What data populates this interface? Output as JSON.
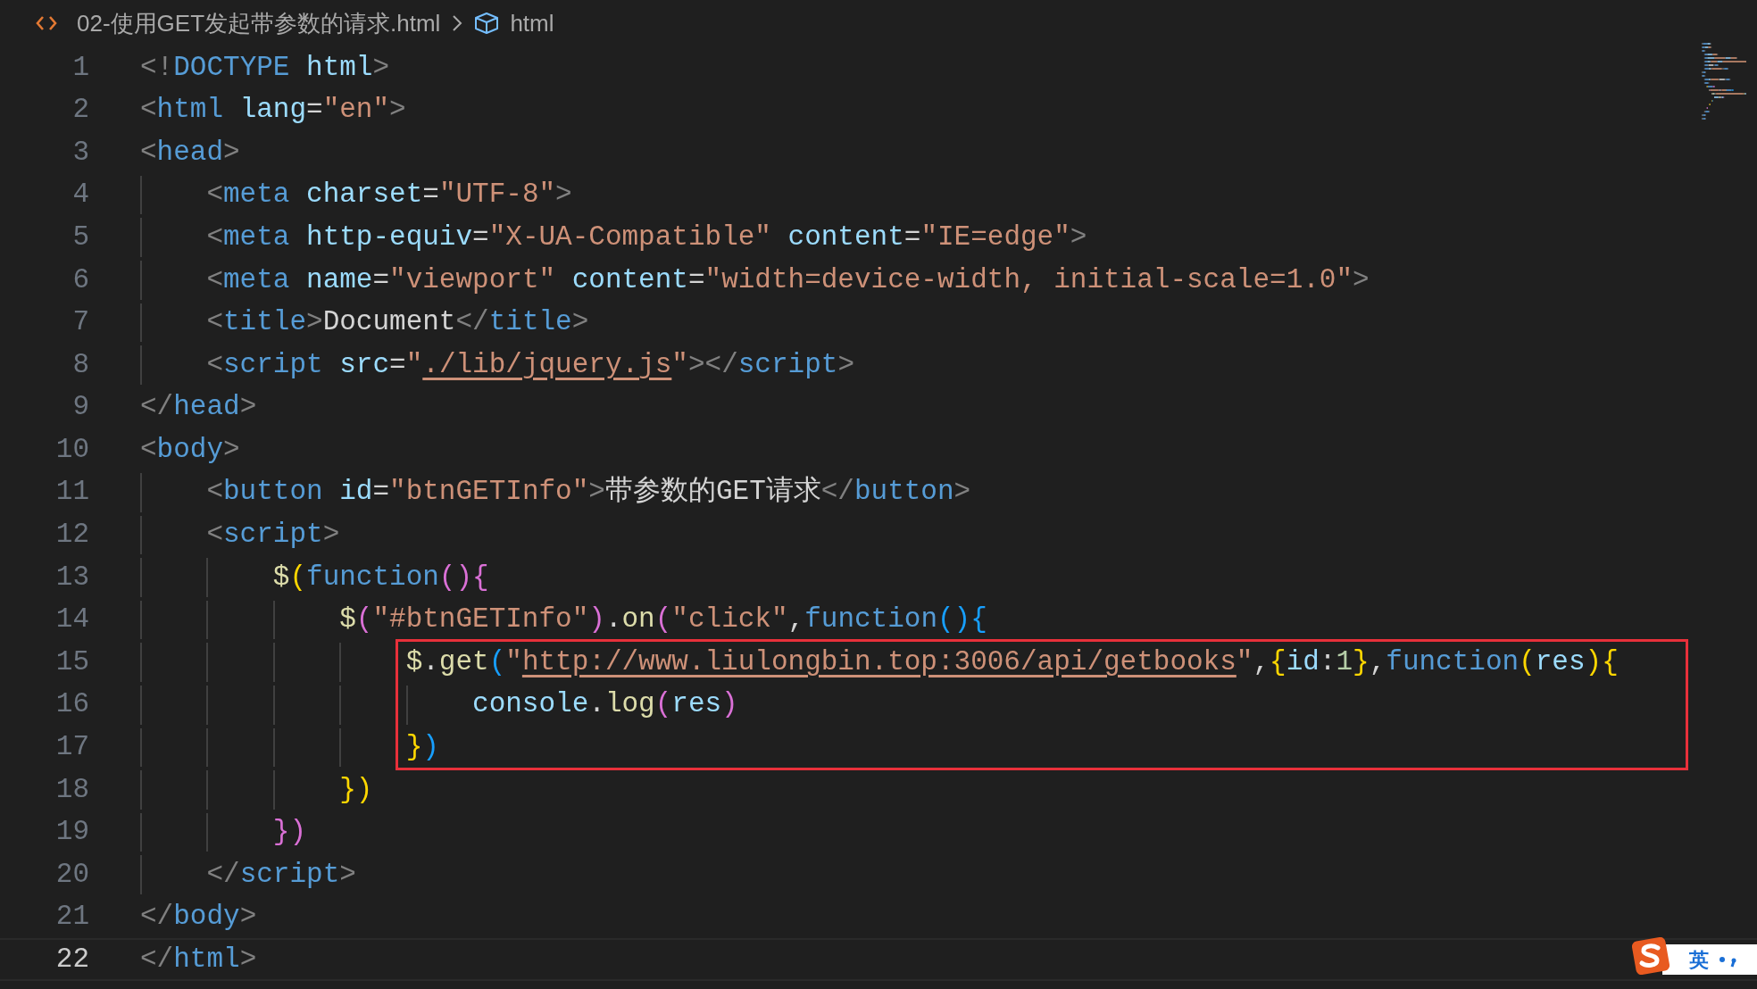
{
  "breadcrumb": {
    "file": "02-使用GET发起带参数的请求.html",
    "symbol": "html"
  },
  "lines": [
    {
      "number": "1",
      "current": false,
      "boxed": false,
      "tokens": [
        {
          "kind": "p",
          "text": "<!"
        },
        {
          "kind": "tag",
          "text": "DOCTYPE"
        },
        {
          "kind": "attr",
          "text": " html"
        },
        {
          "kind": "p",
          "text": ">"
        }
      ]
    },
    {
      "number": "2",
      "current": false,
      "boxed": false,
      "tokens": [
        {
          "kind": "p",
          "text": "<"
        },
        {
          "kind": "tag",
          "text": "html"
        },
        {
          "kind": "attr",
          "text": " lang"
        },
        {
          "kind": "txt",
          "text": "="
        },
        {
          "kind": "str",
          "text": "\"en\""
        },
        {
          "kind": "p",
          "text": ">"
        }
      ]
    },
    {
      "number": "3",
      "current": false,
      "boxed": false,
      "tokens": [
        {
          "kind": "p",
          "text": "<"
        },
        {
          "kind": "tag",
          "text": "head"
        },
        {
          "kind": "p",
          "text": ">"
        }
      ],
      "children": [
        {
          "number": "4",
          "current": false,
          "boxed": false,
          "tokens": [
            {
              "kind": "p",
              "text": "<"
            },
            {
              "kind": "tag",
              "text": "meta"
            },
            {
              "kind": "attr",
              "text": " charset"
            },
            {
              "kind": "txt",
              "text": "="
            },
            {
              "kind": "str",
              "text": "\"UTF-8\""
            },
            {
              "kind": "p",
              "text": ">"
            }
          ]
        },
        {
          "number": "5",
          "current": false,
          "boxed": false,
          "tokens": [
            {
              "kind": "p",
              "text": "<"
            },
            {
              "kind": "tag",
              "text": "meta"
            },
            {
              "kind": "attr",
              "text": " http-equiv"
            },
            {
              "kind": "txt",
              "text": "="
            },
            {
              "kind": "str",
              "text": "\"X-UA-Compatible\""
            },
            {
              "kind": "attr",
              "text": " content"
            },
            {
              "kind": "txt",
              "text": "="
            },
            {
              "kind": "str",
              "text": "\"IE=edge\""
            },
            {
              "kind": "p",
              "text": ">"
            }
          ]
        },
        {
          "number": "6",
          "current": false,
          "boxed": false,
          "tokens": [
            {
              "kind": "p",
              "text": "<"
            },
            {
              "kind": "tag",
              "text": "meta"
            },
            {
              "kind": "attr",
              "text": " name"
            },
            {
              "kind": "txt",
              "text": "="
            },
            {
              "kind": "str",
              "text": "\"viewport\""
            },
            {
              "kind": "attr",
              "text": " content"
            },
            {
              "kind": "txt",
              "text": "="
            },
            {
              "kind": "str",
              "text": "\"width=device-width, initial-scale=1.0\""
            },
            {
              "kind": "p",
              "text": ">"
            }
          ]
        },
        {
          "number": "7",
          "current": false,
          "boxed": false,
          "tokens": [
            {
              "kind": "p",
              "text": "<"
            },
            {
              "kind": "tag",
              "text": "title"
            },
            {
              "kind": "p",
              "text": ">"
            },
            {
              "kind": "txt",
              "text": "Document"
            },
            {
              "kind": "p",
              "text": "</"
            },
            {
              "kind": "tag",
              "text": "title"
            },
            {
              "kind": "p",
              "text": ">"
            }
          ]
        },
        {
          "number": "8",
          "current": false,
          "boxed": false,
          "tokens": [
            {
              "kind": "p",
              "text": "<"
            },
            {
              "kind": "tag",
              "text": "script"
            },
            {
              "kind": "attr",
              "text": " src"
            },
            {
              "kind": "txt",
              "text": "="
            },
            {
              "kind": "str",
              "text": "\""
            },
            {
              "kind": "link",
              "text": "./lib/jquery.js"
            },
            {
              "kind": "str",
              "text": "\""
            },
            {
              "kind": "p",
              "text": "></"
            },
            {
              "kind": "tag",
              "text": "script"
            },
            {
              "kind": "p",
              "text": ">"
            }
          ]
        }
      ]
    },
    {
      "number": "9",
      "current": false,
      "boxed": false,
      "tokens": [
        {
          "kind": "p",
          "text": "</"
        },
        {
          "kind": "tag",
          "text": "head"
        },
        {
          "kind": "p",
          "text": ">"
        }
      ]
    },
    {
      "number": "10",
      "current": false,
      "boxed": false,
      "tokens": [
        {
          "kind": "p",
          "text": "<"
        },
        {
          "kind": "tag",
          "text": "body"
        },
        {
          "kind": "p",
          "text": ">"
        }
      ],
      "children": [
        {
          "number": "11",
          "current": false,
          "boxed": false,
          "tokens": [
            {
              "kind": "p",
              "text": "<"
            },
            {
              "kind": "tag",
              "text": "button"
            },
            {
              "kind": "attr",
              "text": " id"
            },
            {
              "kind": "txt",
              "text": "="
            },
            {
              "kind": "str",
              "text": "\"btnGETInfo\""
            },
            {
              "kind": "p",
              "text": ">"
            },
            {
              "kind": "txt",
              "text": "带参数的GET请求"
            },
            {
              "kind": "p",
              "text": "</"
            },
            {
              "kind": "tag",
              "text": "button"
            },
            {
              "kind": "p",
              "text": ">"
            }
          ]
        },
        {
          "number": "12",
          "current": false,
          "boxed": false,
          "tokens": [
            {
              "kind": "p",
              "text": "<"
            },
            {
              "kind": "tag",
              "text": "script"
            },
            {
              "kind": "p",
              "text": ">"
            }
          ],
          "children": [
            {
              "number": "13",
              "current": false,
              "boxed": false,
              "tokens": [
                {
                  "kind": "fn",
                  "text": "$"
                },
                {
                  "kind": "b1",
                  "text": "("
                },
                {
                  "kind": "kw",
                  "text": "function"
                },
                {
                  "kind": "b2",
                  "text": "(){"
                }
              ],
              "children": [
                {
                  "number": "14",
                  "current": false,
                  "boxed": false,
                  "tokens": [
                    {
                      "kind": "fn",
                      "text": "$"
                    },
                    {
                      "kind": "b2",
                      "text": "("
                    },
                    {
                      "kind": "str",
                      "text": "\"#btnGETInfo\""
                    },
                    {
                      "kind": "b2",
                      "text": ")"
                    },
                    {
                      "kind": "txt",
                      "text": "."
                    },
                    {
                      "kind": "fn",
                      "text": "on"
                    },
                    {
                      "kind": "b2",
                      "text": "("
                    },
                    {
                      "kind": "str",
                      "text": "\"click\""
                    },
                    {
                      "kind": "txt",
                      "text": ","
                    },
                    {
                      "kind": "kw",
                      "text": "function"
                    },
                    {
                      "kind": "b3",
                      "text": "(){"
                    }
                  ],
                  "children": [
                    {
                      "number": "15",
                      "current": false,
                      "boxed": true,
                      "tokens": [
                        {
                          "kind": "fn",
                          "text": "$"
                        },
                        {
                          "kind": "txt",
                          "text": "."
                        },
                        {
                          "kind": "fn",
                          "text": "get"
                        },
                        {
                          "kind": "b3",
                          "text": "("
                        },
                        {
                          "kind": "str",
                          "text": "\""
                        },
                        {
                          "kind": "link",
                          "text": "http://www.liulongbin.top:3006/api/getbooks"
                        },
                        {
                          "kind": "str",
                          "text": "\""
                        },
                        {
                          "kind": "txt",
                          "text": ","
                        },
                        {
                          "kind": "b1",
                          "text": "{"
                        },
                        {
                          "kind": "var",
                          "text": "id"
                        },
                        {
                          "kind": "txt",
                          "text": ":"
                        },
                        {
                          "kind": "num",
                          "text": "1"
                        },
                        {
                          "kind": "b1",
                          "text": "}"
                        },
                        {
                          "kind": "txt",
                          "text": ","
                        },
                        {
                          "kind": "kw",
                          "text": "function"
                        },
                        {
                          "kind": "b1",
                          "text": "("
                        },
                        {
                          "kind": "var",
                          "text": "res"
                        },
                        {
                          "kind": "b1",
                          "text": ")"
                        },
                        {
                          "kind": "b1",
                          "text": "{"
                        }
                      ],
                      "children": [
                        {
                          "number": "16",
                          "current": false,
                          "boxed": true,
                          "tokens": [
                            {
                              "kind": "var",
                              "text": "console"
                            },
                            {
                              "kind": "txt",
                              "text": "."
                            },
                            {
                              "kind": "fn",
                              "text": "log"
                            },
                            {
                              "kind": "b2",
                              "text": "("
                            },
                            {
                              "kind": "var",
                              "text": "res"
                            },
                            {
                              "kind": "b2",
                              "text": ")"
                            }
                          ]
                        }
                      ]
                    },
                    {
                      "number": "17",
                      "current": false,
                      "boxed": true,
                      "tokens": [
                        {
                          "kind": "b1",
                          "text": "}"
                        },
                        {
                          "kind": "b3",
                          "text": ")"
                        }
                      ]
                    }
                  ]
                },
                {
                  "number": "18",
                  "current": false,
                  "boxed": false,
                  "tokens": [
                    {
                      "kind": "b1",
                      "text": "})"
                    }
                  ]
                }
              ]
            },
            {
              "number": "19",
              "current": false,
              "boxed": false,
              "tokens": [
                {
                  "kind": "b2",
                  "text": "})"
                }
              ]
            }
          ]
        },
        {
          "number": "20",
          "current": false,
          "boxed": false,
          "tokens": [
            {
              "kind": "p",
              "text": "</"
            },
            {
              "kind": "tag",
              "text": "script"
            },
            {
              "kind": "p",
              "text": ">"
            }
          ]
        }
      ]
    },
    {
      "number": "21",
      "current": false,
      "boxed": false,
      "tokens": [
        {
          "kind": "p",
          "text": "</"
        },
        {
          "kind": "tag",
          "text": "body"
        },
        {
          "kind": "p",
          "text": ">"
        }
      ]
    },
    {
      "number": "22",
      "current": true,
      "boxed": false,
      "tokens": [
        {
          "kind": "p",
          "text": "</"
        },
        {
          "kind": "tag",
          "text": "html"
        },
        {
          "kind": "p",
          "text": ">"
        }
      ]
    }
  ],
  "ime_toolbar": {
    "mode": "英"
  }
}
